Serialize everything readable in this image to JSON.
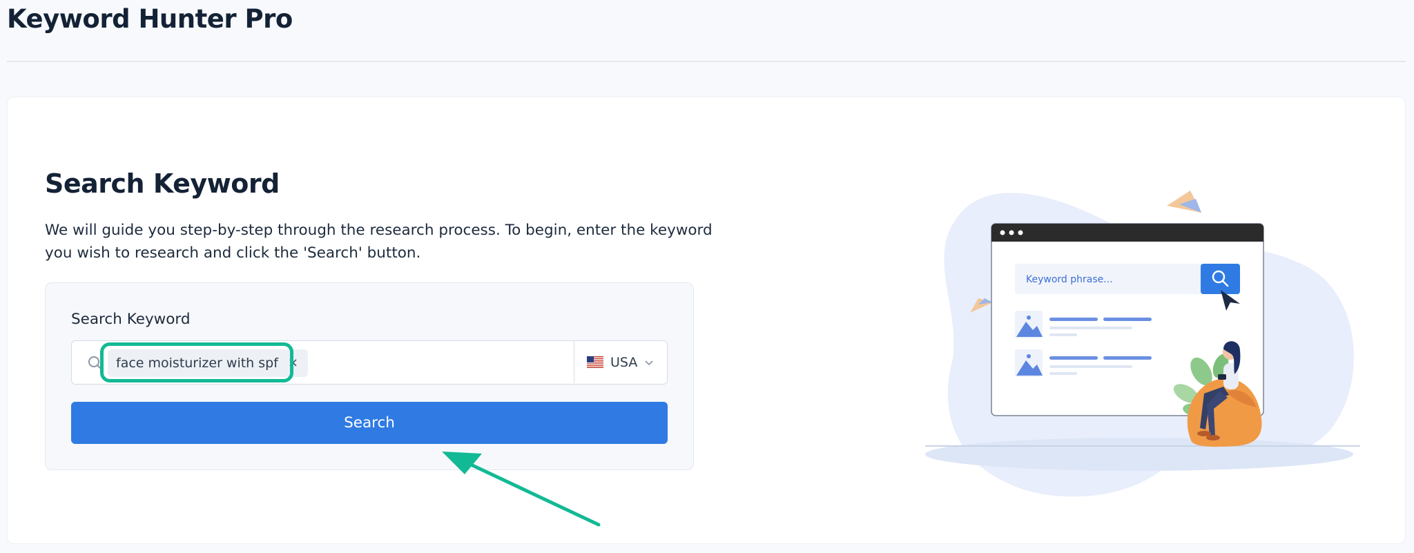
{
  "app": {
    "title": "Keyword Hunter Pro"
  },
  "section": {
    "title": "Search Keyword",
    "intro": "We will guide you step-by-step through the research process. To begin, enter the keyword you wish to research and click the 'Search' button."
  },
  "form": {
    "label": "Search Keyword",
    "tags": [
      {
        "text": "face moisturizer with spf",
        "remove_glyph": "×"
      }
    ],
    "country": {
      "flag_icon": "us-flag-icon",
      "value": "USA"
    },
    "search_button": "Search"
  },
  "illustration": {
    "search_placeholder": "Keyword phrase..."
  },
  "colors": {
    "accent": "#2f7be3",
    "highlight": "#12b995",
    "title": "#142236",
    "background": "#f7f9fc"
  }
}
